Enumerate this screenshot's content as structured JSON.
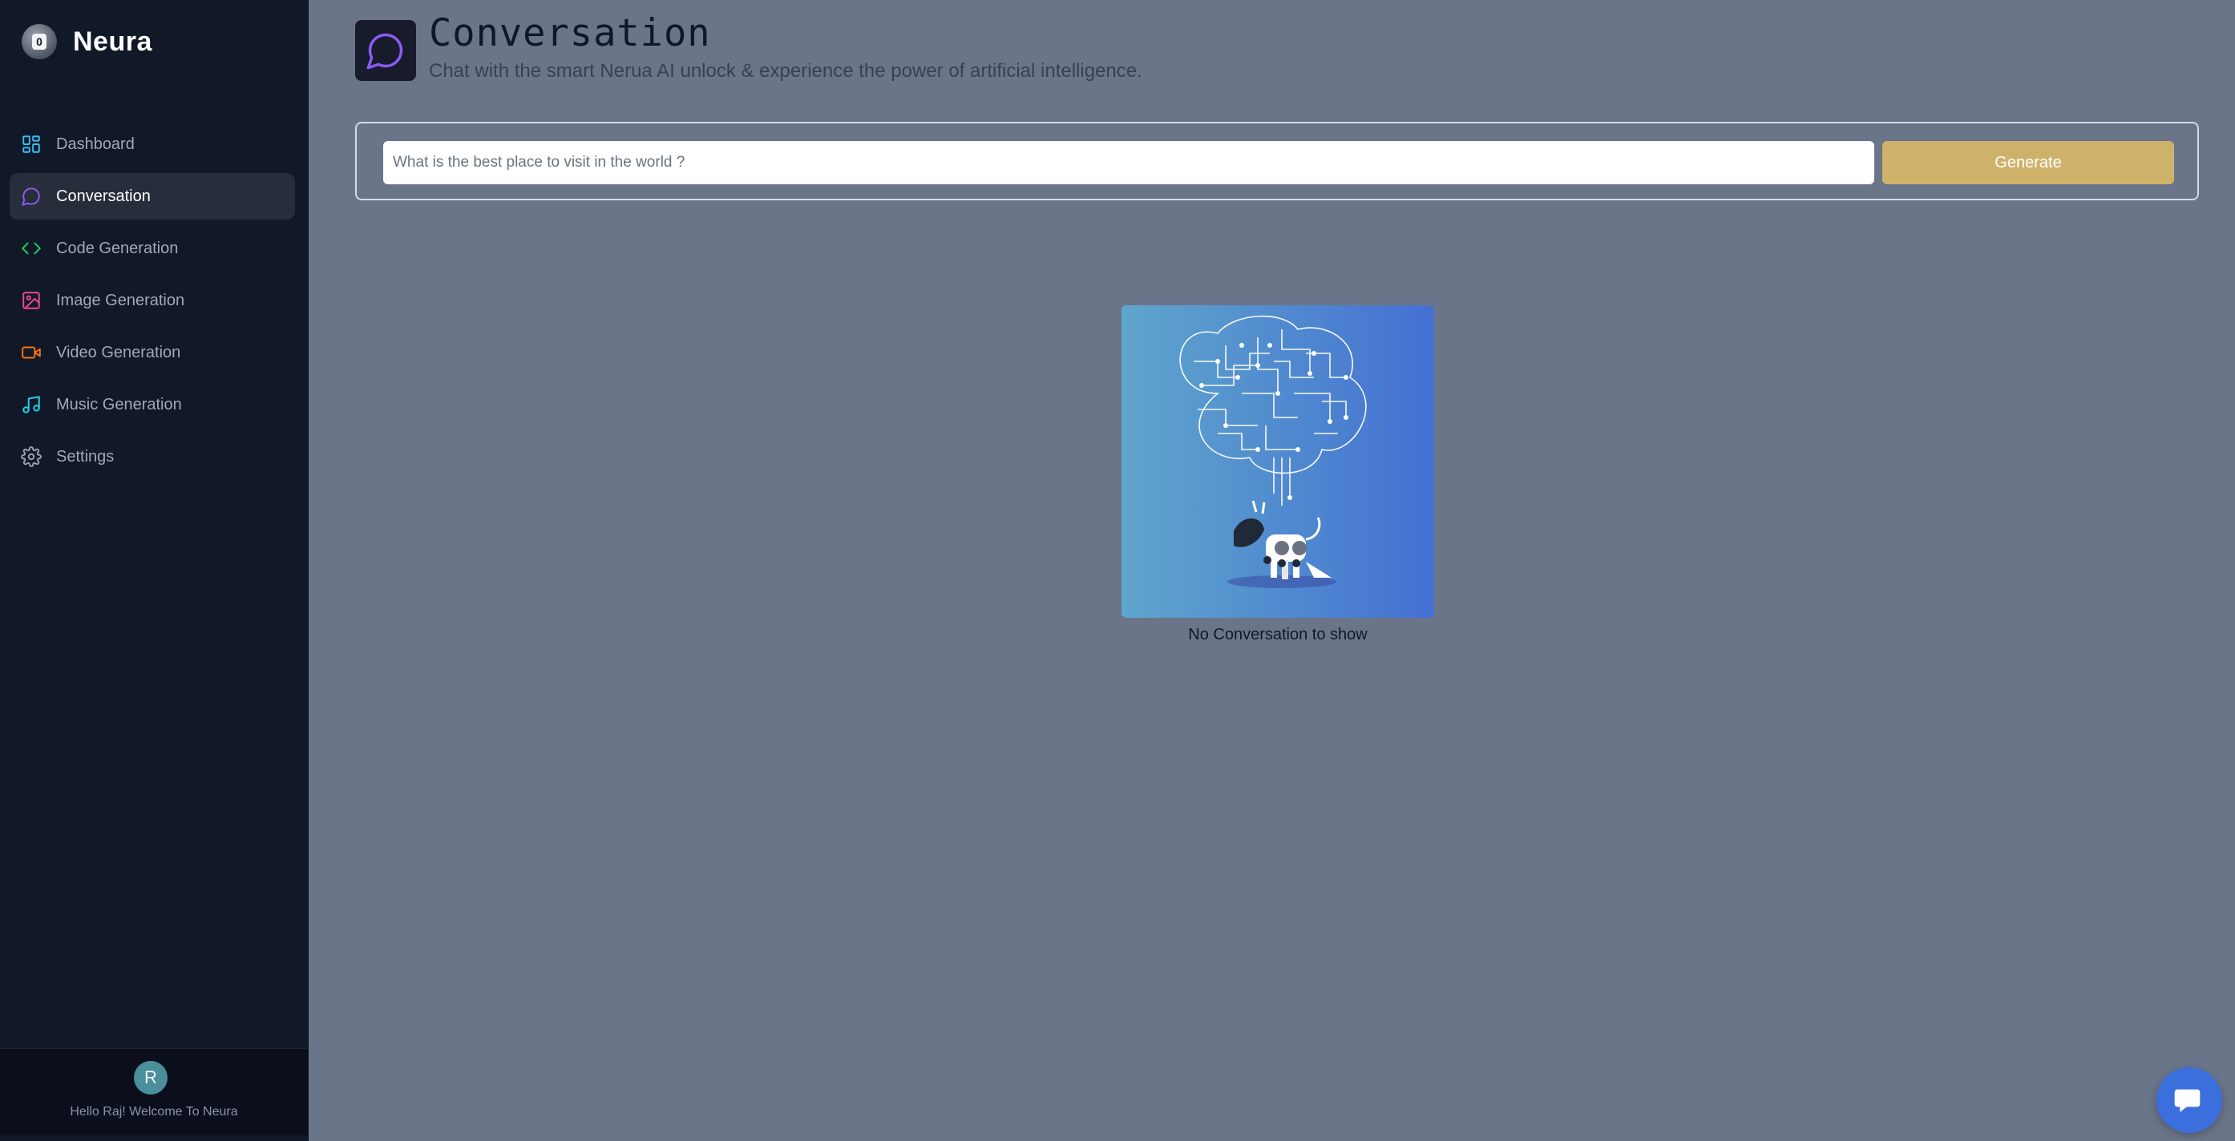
{
  "app": {
    "name": "Neura",
    "logo_letter": "0"
  },
  "sidebar": {
    "items": [
      {
        "label": "Dashboard",
        "icon": "dashboard-icon",
        "color": "#38bdf8"
      },
      {
        "label": "Conversation",
        "icon": "message-circle-icon",
        "color": "#8b5cf6",
        "active": true
      },
      {
        "label": "Code Generation",
        "icon": "code-icon",
        "color": "#22c55e"
      },
      {
        "label": "Image Generation",
        "icon": "image-icon",
        "color": "#ec4899"
      },
      {
        "label": "Video Generation",
        "icon": "video-icon",
        "color": "#f97316"
      },
      {
        "label": "Music Generation",
        "icon": "music-icon",
        "color": "#22d3ee"
      },
      {
        "label": "Settings",
        "icon": "settings-gear-icon",
        "color": "#9ca3af"
      }
    ],
    "user": {
      "initial": "R",
      "welcome": "Hello Raj! Welcome To Neura"
    }
  },
  "header": {
    "title": "Conversation",
    "subtitle": "Chat with the smart Nerua AI unlock & experience the power of artificial intelligence.",
    "icon": "message-circle-icon",
    "icon_color": "#8b5cf6"
  },
  "prompt": {
    "placeholder": "What is the best place to visit in the world ?",
    "value": "",
    "button_label": "Generate",
    "button_color": "#cfb26a"
  },
  "empty_state": {
    "text": "No Conversation to show"
  },
  "chat_widget": {
    "icon": "chat-bubble-icon",
    "color": "#3b6fde"
  }
}
